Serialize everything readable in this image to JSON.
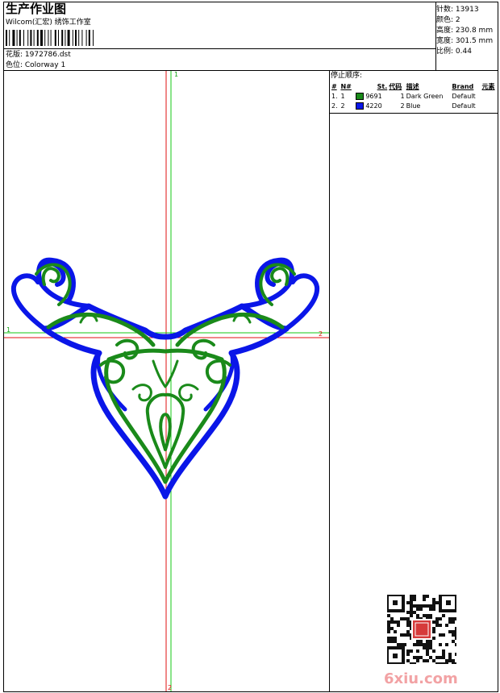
{
  "header": {
    "title": "生产作业图",
    "company": "Wilcom(汇宏) 绣饰工作室",
    "design_label": "花版: 1972786.dst",
    "colorway_label": "色位:  Colorway 1"
  },
  "stats": [
    {
      "label": "针数",
      "value": "13913"
    },
    {
      "label": "颜色",
      "value": "2"
    },
    {
      "label": "高度",
      "value": "230.8 mm"
    },
    {
      "label": "宽度",
      "value": "301.5 mm"
    },
    {
      "label": "比例",
      "value": "0.44"
    }
  ],
  "stop_sequence": {
    "title": "停止顺序:",
    "columns": [
      "#",
      "N#",
      "St.",
      "代码",
      "描述",
      "Brand",
      "元素"
    ],
    "rows": [
      {
        "idx": "1.",
        "n": "1",
        "color": "#1a8a1a",
        "code": "9691",
        "st": "1",
        "desc": "Dark Green",
        "brand": "Default",
        "element": ""
      },
      {
        "idx": "2.",
        "n": "2",
        "color": "#0a16e8",
        "code": "4220",
        "st": "2",
        "desc": "Blue",
        "brand": "Default",
        "element": ""
      }
    ]
  },
  "axes": {
    "v_top": "1",
    "v_bottom": "2",
    "h_left": "1",
    "h_right": "2"
  },
  "colors": {
    "green": "#1a8a1a",
    "blue": "#0a16e8",
    "red_line": "#e01010",
    "green_line": "#14c814"
  },
  "watermark": "6xiu.com",
  "qr_stamp": "qr-code-with-red-seal"
}
